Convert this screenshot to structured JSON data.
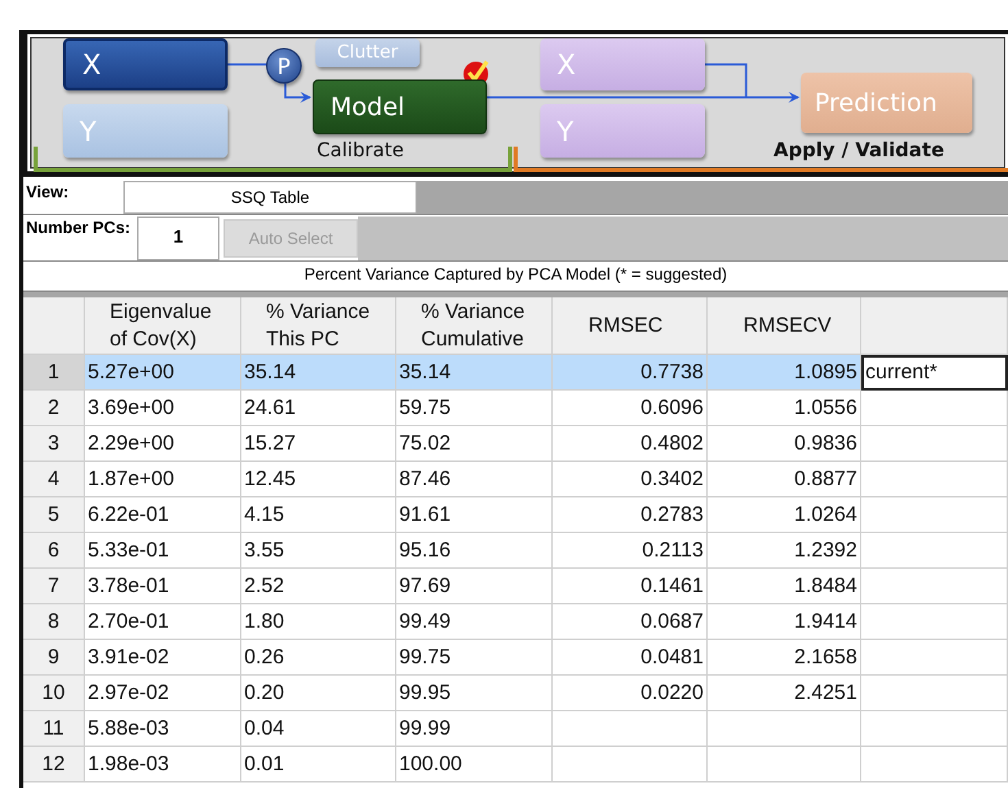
{
  "diagram": {
    "nodes": [
      {
        "kind": "x-calibrate",
        "label": "X"
      },
      {
        "kind": "y-calibrate",
        "label": "Y"
      },
      {
        "kind": "preprocess",
        "label": "P"
      },
      {
        "kind": "clutter",
        "label": "Clutter"
      },
      {
        "kind": "model",
        "label": "Model"
      },
      {
        "kind": "x-apply",
        "label": "X"
      },
      {
        "kind": "y-apply",
        "label": "Y"
      },
      {
        "kind": "prediction",
        "label": "Prediction"
      }
    ],
    "sections": [
      {
        "kind": "calibrate",
        "label": "Calibrate"
      },
      {
        "kind": "apply",
        "label": "Apply / Validate"
      }
    ]
  },
  "view": {
    "label": "View:",
    "value": "SSQ Table"
  },
  "number_pcs": {
    "label": "Number PCs:",
    "value": "1"
  },
  "auto_select": {
    "label": "Auto Select",
    "disabled": true
  },
  "caption": "Percent Variance Captured by PCA Model (* = suggested)",
  "table": {
    "columns": [
      {
        "label": "Eigenvalue\nof Cov(X)",
        "kind": "text"
      },
      {
        "label": "% Variance\nThis PC",
        "kind": "text"
      },
      {
        "label": "% Variance\nCumulative",
        "kind": "text"
      },
      {
        "label": "RMSEC",
        "kind": "number"
      },
      {
        "label": "RMSECV",
        "kind": "number"
      }
    ],
    "rows": [
      {
        "index": "1",
        "cells": [
          "5.27e+00",
          "35.14",
          "35.14",
          "0.7738",
          "1.0895"
        ],
        "note": "current*",
        "selected": true
      },
      {
        "index": "2",
        "cells": [
          "3.69e+00",
          "24.61",
          "59.75",
          "0.6096",
          "1.0556"
        ],
        "selected": false
      },
      {
        "index": "3",
        "cells": [
          "2.29e+00",
          "15.27",
          "75.02",
          "0.4802",
          "0.9836"
        ],
        "selected": false
      },
      {
        "index": "4",
        "cells": [
          "1.87e+00",
          "12.45",
          "87.46",
          "0.3402",
          "0.8877"
        ],
        "selected": false
      },
      {
        "index": "5",
        "cells": [
          "6.22e-01",
          "4.15",
          "91.61",
          "0.2783",
          "1.0264"
        ],
        "selected": false
      },
      {
        "index": "6",
        "cells": [
          "5.33e-01",
          "3.55",
          "95.16",
          "0.2113",
          "1.2392"
        ],
        "selected": false
      },
      {
        "index": "7",
        "cells": [
          "3.78e-01",
          "2.52",
          "97.69",
          "0.1461",
          "1.8484"
        ],
        "selected": false
      },
      {
        "index": "8",
        "cells": [
          "2.70e-01",
          "1.80",
          "99.49",
          "0.0687",
          "1.9414"
        ],
        "selected": false
      },
      {
        "index": "9",
        "cells": [
          "3.91e-02",
          "0.26",
          "99.75",
          "0.0481",
          "2.1658"
        ],
        "selected": false
      },
      {
        "index": "10",
        "cells": [
          "2.97e-02",
          "0.20",
          "99.95",
          "0.0220",
          "2.4251"
        ],
        "selected": false
      },
      {
        "index": "11",
        "cells": [
          "5.88e-03",
          "0.04",
          "99.99"
        ],
        "selected": false
      },
      {
        "index": "12",
        "cells": [
          "1.98e-03",
          "0.01",
          "100.00"
        ],
        "selected": false
      }
    ]
  }
}
